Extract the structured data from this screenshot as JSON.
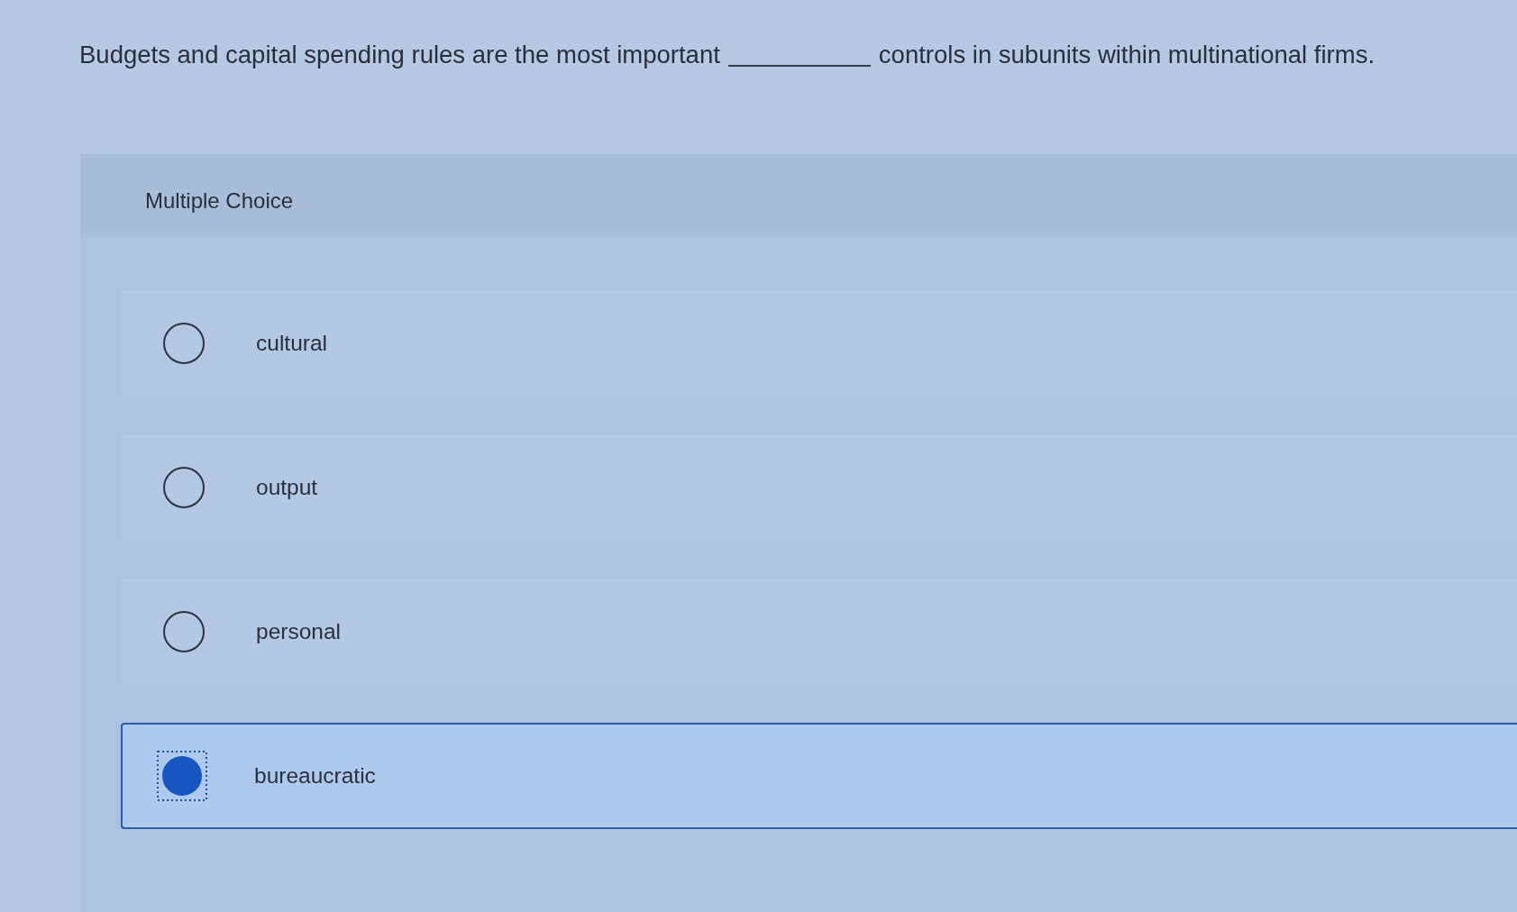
{
  "question": {
    "before_blank": "Budgets and capital spending rules are the most important",
    "after_blank": "controls in subunits within multinational firms."
  },
  "answer_block": {
    "heading": "Multiple Choice",
    "options": [
      {
        "label": "cultural",
        "selected": false
      },
      {
        "label": "output",
        "selected": false
      },
      {
        "label": "personal",
        "selected": false
      },
      {
        "label": "bureaucratic",
        "selected": true
      }
    ]
  }
}
